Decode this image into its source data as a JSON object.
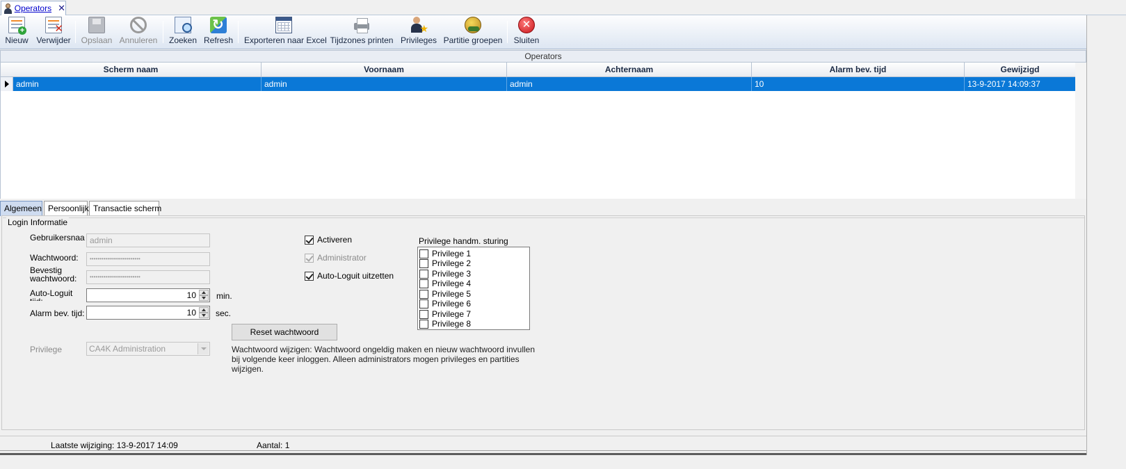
{
  "window": {
    "tab_title": "Operators",
    "close_glyph": "✕"
  },
  "toolbar": {
    "nieuw": "Nieuw",
    "verwijder": "Verwijder",
    "opslaan": "Opslaan",
    "annuleren": "Annuleren",
    "zoeken": "Zoeken",
    "refresh": "Refresh",
    "exporteren": "Exporteren naar Excel",
    "tijdzones": "Tijdzones printen",
    "privileges": "Privileges",
    "partitie": "Partitie groepen",
    "sluiten": "Sluiten"
  },
  "grid": {
    "caption": "Operators",
    "columns": [
      "Scherm naam",
      "Voornaam",
      "Achternaam",
      "Alarm bev. tijd",
      "Gewijzigd"
    ],
    "rows": [
      [
        "admin",
        "admin",
        "admin",
        "10",
        "13-9-2017 14:09:37"
      ]
    ],
    "selection_color": "#0a78d7"
  },
  "tabs": [
    "Algemeen",
    "Persoonlijk",
    "Transactie scherm"
  ],
  "login": {
    "group_title": "Login Informatie",
    "gebruikersnaam_label": "Gebruikersnaa\nm:",
    "gebruikersnaam_value": "admin",
    "wachtwoord_label": "Wachtwoord:",
    "wachtwoord_value": "••••••••••••••••••••••••••",
    "bevestig_label": "Bevestig\nwachtwoord:",
    "bevestig_value": "••••••••••••••••••••••••••",
    "autologuit_label": "Auto-Loguit\ntijd:",
    "autologuit_value": "10",
    "autologuit_unit": "min.",
    "alarm_label": "Alarm bev. tijd:",
    "alarm_value": "10",
    "alarm_unit": "sec.",
    "privilege_label": "Privilege",
    "privilege_value": "CA4K Administration",
    "activeren": "Activeren",
    "administrator": "Administrator",
    "autologuit_uitzetten": "Auto-Loguit uitzetten",
    "reset_button": "Reset wachtwoord",
    "info_text": "Wachtwoord wijzigen: Wachtwoord ongeldig maken en nieuw wachtwoord invullen bij volgende keer inloggen. Alleen administrators mogen privileges en partities wijzigen."
  },
  "privileges": {
    "title": "Privilege handm. sturing",
    "items": [
      "Privilege 1",
      "Privilege 2",
      "Privilege 3",
      "Privilege 4",
      "Privilege 5",
      "Privilege 6",
      "Privilege 7",
      "Privilege 8"
    ]
  },
  "status": {
    "laatste": "Laatste wijziging: 13-9-2017 14:09",
    "aantal": "Aantal: 1"
  }
}
